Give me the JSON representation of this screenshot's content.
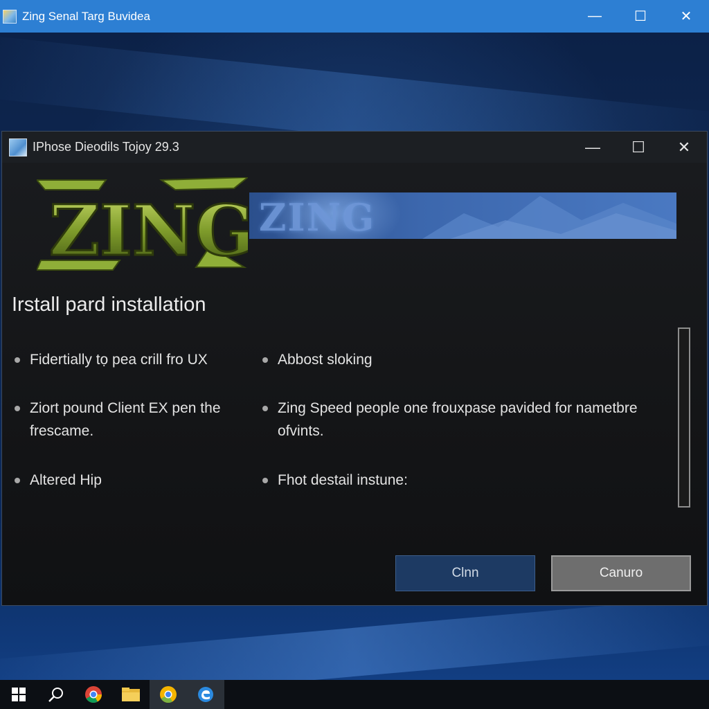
{
  "outer_window": {
    "title": "Zing Senal Targ Buvidea",
    "controls": {
      "minimize": "—",
      "maximize": "☐",
      "close": "✕"
    }
  },
  "dialog": {
    "title": "IPhose Dieodils Tojoy 29.3",
    "controls": {
      "minimize": "—",
      "maximize": "☐",
      "close": "✕"
    },
    "logo_text": "ZING",
    "banner_text": "ZING",
    "heading": "Irstall pard installation",
    "bullets_left": [
      "Fidertially tọ pea crill fro UX",
      "Ziort pound Client EX pen the frescame.",
      "Altered Hip"
    ],
    "bullets_right": [
      "Abbost sloking",
      "Zing Speed people one frouxpase pavided for nametbre ofvints.",
      "Fhot destail instune:"
    ],
    "buttons": {
      "primary": "Clnn",
      "secondary": "Canuro"
    }
  },
  "taskbar": {
    "items": [
      "windows-start-icon",
      "search-icon",
      "chrome-icon",
      "file-explorer-icon",
      "chrome-canary-icon",
      "edge-icon"
    ]
  },
  "colors": {
    "outer_titlebar": "#2d7fd3",
    "dialog_bg": "#141517",
    "logo_green": "#7a9a2c",
    "banner_blue": "#3c67ad",
    "primary_button": "#1d3a63",
    "secondary_button": "#6e6e6e"
  }
}
